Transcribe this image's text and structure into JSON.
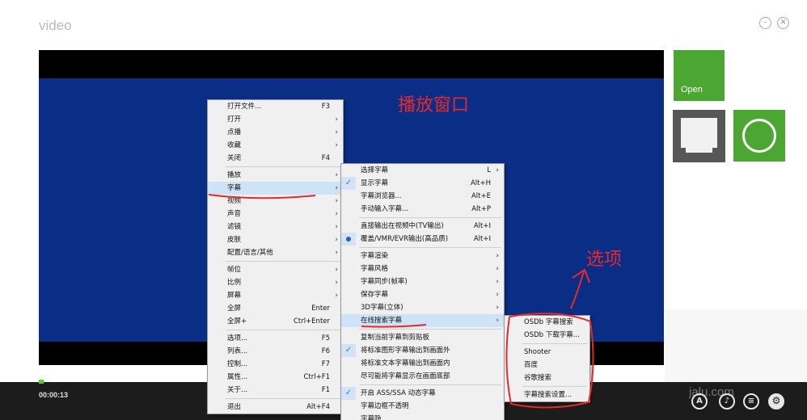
{
  "app": {
    "title": "video"
  },
  "window": {
    "minimize_icon": "minimize-icon",
    "close_icon": "close-icon"
  },
  "annotations": {
    "player_window": "播放窗口",
    "options": "选项"
  },
  "tiles": {
    "open_label": "Open"
  },
  "playback": {
    "elapsed": "00:00:13",
    "watermark": "jalu.com"
  },
  "controls": [
    {
      "icon": "subtitle-icon",
      "glyph": "A"
    },
    {
      "icon": "music-icon",
      "glyph": "♪"
    },
    {
      "icon": "playlist-icon",
      "glyph": "≡"
    },
    {
      "icon": "settings-gear-icon",
      "glyph": "⚙"
    }
  ],
  "context_menu": {
    "groups": [
      [
        {
          "label": "打开文件...",
          "shortcut": "F3",
          "submenu": false
        },
        {
          "label": "打开",
          "shortcut": "",
          "submenu": true
        },
        {
          "label": "点播",
          "shortcut": "",
          "submenu": true
        },
        {
          "label": "收藏",
          "shortcut": "",
          "submenu": true
        },
        {
          "label": "关闭",
          "shortcut": "F4",
          "submenu": false
        }
      ],
      [
        {
          "label": "播放",
          "shortcut": "",
          "submenu": true
        },
        {
          "label": "字幕",
          "shortcut": "",
          "submenu": true,
          "highlighted": true
        },
        {
          "label": "视频",
          "shortcut": "",
          "submenu": true
        },
        {
          "label": "声音",
          "shortcut": "",
          "submenu": true
        },
        {
          "label": "滤镜",
          "shortcut": "",
          "submenu": true
        },
        {
          "label": "皮肤",
          "shortcut": "",
          "submenu": true
        },
        {
          "label": "配置/语言/其他",
          "shortcut": "",
          "submenu": true
        }
      ],
      [
        {
          "label": "帧位",
          "shortcut": "",
          "submenu": true
        },
        {
          "label": "比例",
          "shortcut": "",
          "submenu": true
        },
        {
          "label": "屏幕",
          "shortcut": "",
          "submenu": true
        },
        {
          "label": "全屏",
          "shortcut": "Enter",
          "submenu": false
        },
        {
          "label": "全屏+",
          "shortcut": "Ctrl+Enter",
          "submenu": false
        }
      ],
      [
        {
          "label": "选项...",
          "shortcut": "F5",
          "submenu": false
        },
        {
          "label": "列表...",
          "shortcut": "F6",
          "submenu": false
        },
        {
          "label": "控制...",
          "shortcut": "F7",
          "submenu": false
        },
        {
          "label": "属性...",
          "shortcut": "Ctrl+F1",
          "submenu": false
        },
        {
          "label": "关于...",
          "shortcut": "F1",
          "submenu": false
        }
      ],
      [
        {
          "label": "退出",
          "shortcut": "Alt+F4",
          "submenu": false
        }
      ]
    ]
  },
  "subtitle_menu": {
    "groups": [
      [
        {
          "label": "选择字幕",
          "shortcut": "L",
          "submenu": true
        },
        {
          "label": "显示字幕",
          "shortcut": "Alt+H",
          "mark": "check"
        },
        {
          "label": "字幕浏览器...",
          "shortcut": "Alt+E"
        },
        {
          "label": "手动输入字幕...",
          "shortcut": "Alt+P"
        }
      ],
      [
        {
          "label": "直接输出在视频中(TV输出)",
          "shortcut": "Alt+I"
        },
        {
          "label": "覆盖/VMR/EVR输出(高品质)",
          "shortcut": "Alt+I",
          "mark": "radio"
        }
      ],
      [
        {
          "label": "字幕渲染",
          "shortcut": "",
          "submenu": true
        },
        {
          "label": "字幕风格",
          "shortcut": "",
          "submenu": true
        },
        {
          "label": "字幕同步(帧率)",
          "shortcut": "",
          "submenu": true
        },
        {
          "label": "保存字幕",
          "shortcut": "",
          "submenu": true
        },
        {
          "label": "3D字幕(立体)",
          "shortcut": "",
          "submenu": true
        },
        {
          "label": "在线搜索字幕",
          "shortcut": "",
          "submenu": true,
          "highlighted": true
        }
      ],
      [
        {
          "label": "复制当前字幕到剪贴板",
          "shortcut": ""
        },
        {
          "label": "将标准图形字幕输出到画面外",
          "shortcut": "",
          "mark": "check"
        },
        {
          "label": "将标准文本字幕输出到画面内",
          "shortcut": ""
        },
        {
          "label": "尽可能将字幕显示在画面底部",
          "shortcut": ""
        }
      ],
      [
        {
          "label": "开启 ASS/SSA 动态字幕",
          "shortcut": "",
          "mark": "check"
        },
        {
          "label": "字幕边框不透明",
          "shortcut": ""
        },
        {
          "label": "字幕隐",
          "shortcut": ""
        }
      ]
    ]
  },
  "search_menu": {
    "groups": [
      [
        {
          "label": "OSDb 字幕搜索"
        },
        {
          "label": "OSDb 下载字幕..."
        }
      ],
      [
        {
          "label": "Shooter"
        },
        {
          "label": "百度"
        },
        {
          "label": "谷歌搜索"
        }
      ],
      [
        {
          "label": "字幕搜索设置..."
        }
      ]
    ]
  },
  "colors": {
    "accent_green": "#4ba731",
    "video_blue": "#0a2e86",
    "annotation_red": "#e8282a",
    "menu_highlight": "#cfe3f8"
  }
}
